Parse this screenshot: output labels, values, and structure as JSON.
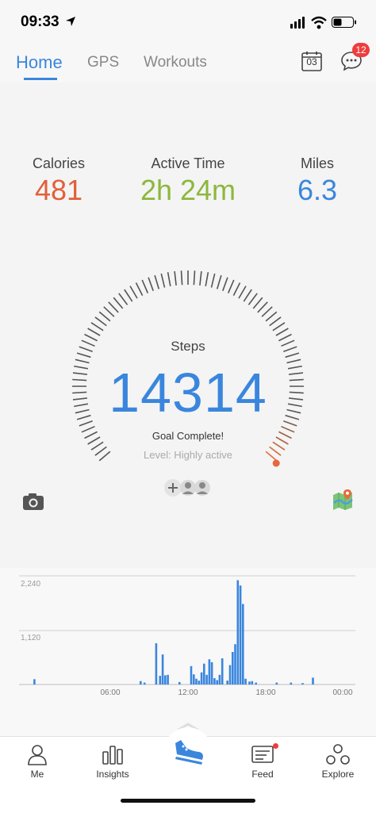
{
  "status_bar": {
    "time": "09:33"
  },
  "nav": {
    "tabs": [
      {
        "label": "Home",
        "active": true
      },
      {
        "label": "GPS",
        "active": false
      },
      {
        "label": "Workouts",
        "active": false
      }
    ],
    "calendar_day": "03",
    "message_count": "12",
    "accent_color": "#3a86dd"
  },
  "stats": [
    {
      "label": "Calories",
      "value": "481",
      "color": "#e0603a"
    },
    {
      "label": "Active Time",
      "value": "2h 24m",
      "color": "#8cb83c"
    },
    {
      "label": "Miles",
      "value": "6.3",
      "color": "#3a86dd"
    }
  ],
  "steps": {
    "label": "Steps",
    "value": "14314",
    "goal_text": "Goal Complete!",
    "level_text": "Level: Highly active",
    "goal_fraction": 1.0
  },
  "chart_data": {
    "type": "bar",
    "y_ticks": [
      "2,240",
      "1,120"
    ],
    "x_ticks": [
      "06:00",
      "12:00",
      "18:00",
      "00:00"
    ],
    "ylim": [
      0,
      2240
    ],
    "x_range_hours": [
      0,
      24
    ],
    "bars": [
      {
        "hour": 0.2,
        "value": 110
      },
      {
        "hour": 8.4,
        "value": 70
      },
      {
        "hour": 8.7,
        "value": 40
      },
      {
        "hour": 9.6,
        "value": 850
      },
      {
        "hour": 9.9,
        "value": 180
      },
      {
        "hour": 10.1,
        "value": 620
      },
      {
        "hour": 10.3,
        "value": 190
      },
      {
        "hour": 10.5,
        "value": 200
      },
      {
        "hour": 11.4,
        "value": 50
      },
      {
        "hour": 12.3,
        "value": 380
      },
      {
        "hour": 12.5,
        "value": 210
      },
      {
        "hour": 12.7,
        "value": 120
      },
      {
        "hour": 12.9,
        "value": 80
      },
      {
        "hour": 13.1,
        "value": 250
      },
      {
        "hour": 13.3,
        "value": 430
      },
      {
        "hour": 13.5,
        "value": 200
      },
      {
        "hour": 13.7,
        "value": 520
      },
      {
        "hour": 13.9,
        "value": 460
      },
      {
        "hour": 14.1,
        "value": 130
      },
      {
        "hour": 14.3,
        "value": 90
      },
      {
        "hour": 14.5,
        "value": 200
      },
      {
        "hour": 14.7,
        "value": 540
      },
      {
        "hour": 15.1,
        "value": 80
      },
      {
        "hour": 15.3,
        "value": 400
      },
      {
        "hour": 15.5,
        "value": 670
      },
      {
        "hour": 15.7,
        "value": 830
      },
      {
        "hour": 15.9,
        "value": 2150
      },
      {
        "hour": 16.1,
        "value": 2040
      },
      {
        "hour": 16.3,
        "value": 1660
      },
      {
        "hour": 16.5,
        "value": 120
      },
      {
        "hour": 16.8,
        "value": 60
      },
      {
        "hour": 17.0,
        "value": 70
      },
      {
        "hour": 17.3,
        "value": 40
      },
      {
        "hour": 18.9,
        "value": 40
      },
      {
        "hour": 20.0,
        "value": 40
      },
      {
        "hour": 20.9,
        "value": 30
      },
      {
        "hour": 21.7,
        "value": 140
      }
    ],
    "bar_color": "#3a86dd"
  },
  "bottom_tabs": [
    {
      "label": "Me",
      "icon": "person-icon"
    },
    {
      "label": "Insights",
      "icon": "bar-chart-icon"
    },
    {
      "label": "",
      "icon": "shoe-icon"
    },
    {
      "label": "Feed",
      "icon": "feed-icon"
    },
    {
      "label": "Explore",
      "icon": "explore-icon"
    }
  ]
}
